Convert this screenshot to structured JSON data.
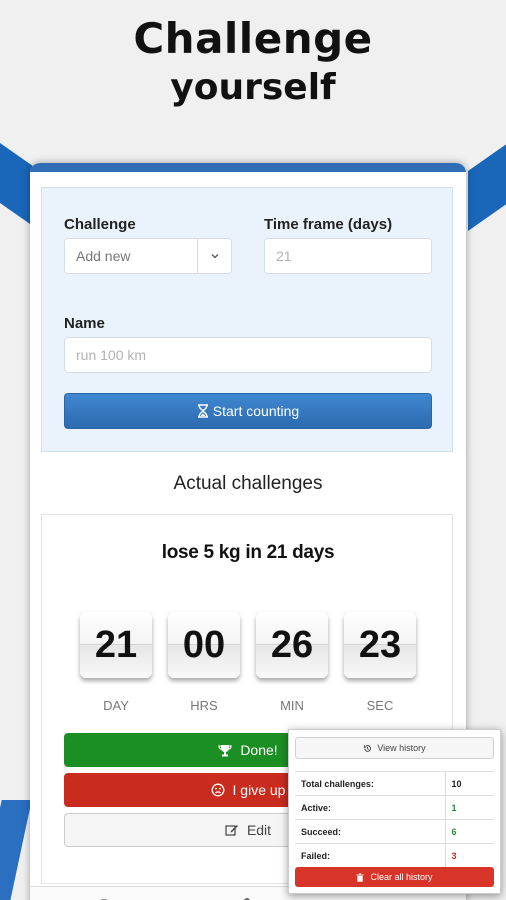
{
  "promo": {
    "title_line1": "Challenge",
    "title_line2": "yourself"
  },
  "form": {
    "challenge_label": "Challenge",
    "challenge_value": "Add new",
    "timeframe_label": "Time frame (days)",
    "timeframe_placeholder": "21",
    "name_label": "Name",
    "name_placeholder": "run 100 km",
    "start_button": "Start counting"
  },
  "actual": {
    "section_title": "Actual challenges",
    "challenge_name": "lose 5 kg in 21 days",
    "countdown": [
      {
        "value": "21",
        "unit": "DAY"
      },
      {
        "value": "00",
        "unit": "HRS"
      },
      {
        "value": "26",
        "unit": "MIN"
      },
      {
        "value": "23",
        "unit": "SEC"
      }
    ],
    "done_button": "Done!",
    "giveup_button": "I give up",
    "edit_button": "Edit"
  },
  "history_popup": {
    "view_history": "View history",
    "rows": [
      {
        "label": "Total challenges:",
        "value": "10",
        "color": "#222222"
      },
      {
        "label": "Active:",
        "value": "1",
        "color": "#2a8a3a"
      },
      {
        "label": "Succeed:",
        "value": "6",
        "color": "#2a8a3a"
      },
      {
        "label": "Failed:",
        "value": "3",
        "color": "#c92b1e"
      }
    ],
    "clear_button": "Clear all history"
  },
  "colors": {
    "accent_blue": "#2f6db5",
    "success_green": "#1c8f24",
    "danger_red": "#c92b1e"
  }
}
